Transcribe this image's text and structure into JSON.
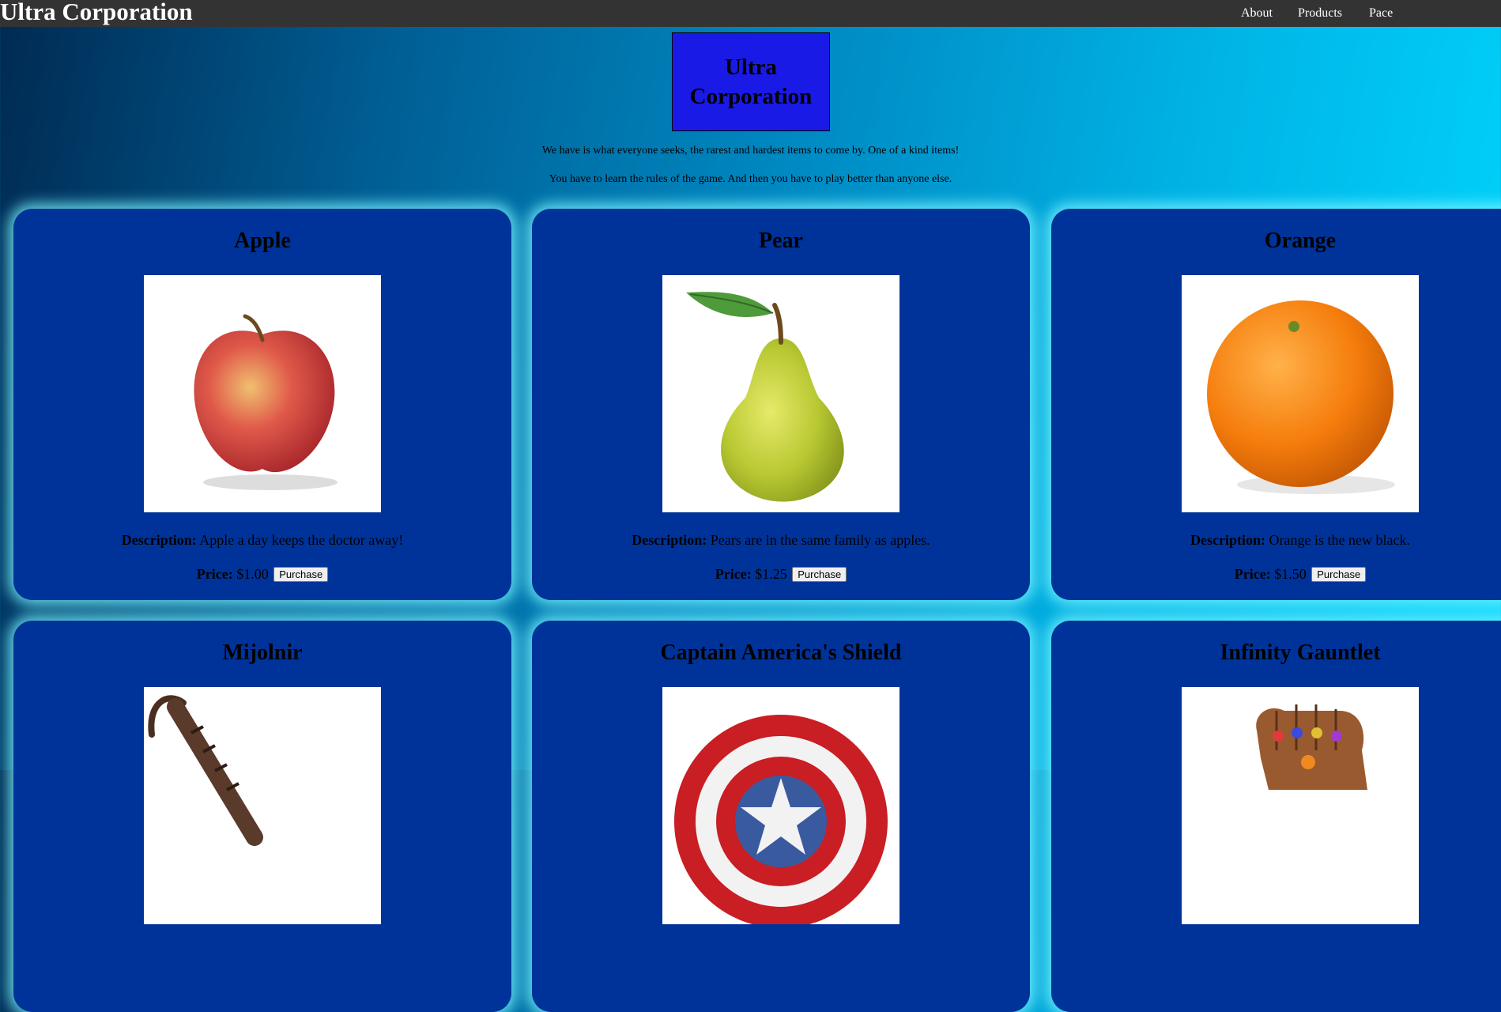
{
  "header": {
    "brand": "Ultra Corporation",
    "nav": [
      "About",
      "Products",
      "Pace"
    ]
  },
  "hero": {
    "title": "Ultra Corporation",
    "taglines": [
      "We have is what everyone seeks, the rarest and hardest items to come by. One of a kind items!",
      "You have to learn the rules of the game. And then you have to play better than anyone else."
    ]
  },
  "labels": {
    "description": "Description:",
    "price": "Price:",
    "purchase": "Purchase"
  },
  "products": [
    {
      "name": "Apple",
      "description": "Apple a day keeps the doctor away!",
      "price": "$1.00",
      "image": "apple-image"
    },
    {
      "name": "Pear",
      "description": "Pears are in the same family as apples.",
      "price": "$1.25",
      "image": "pear-image"
    },
    {
      "name": "Orange",
      "description": "Orange is the new black.",
      "price": "$1.50",
      "image": "orange-image"
    },
    {
      "name": "Mijolnir",
      "image": "hammer-image"
    },
    {
      "name": "Captain America's Shield",
      "image": "shield-image"
    },
    {
      "name": "Infinity Gauntlet",
      "image": "gauntlet-image"
    }
  ],
  "colors": {
    "topbar": "#333333",
    "hero_box": "#1a1ae6",
    "card": "#003399",
    "card_glow": "#78f5ff"
  }
}
